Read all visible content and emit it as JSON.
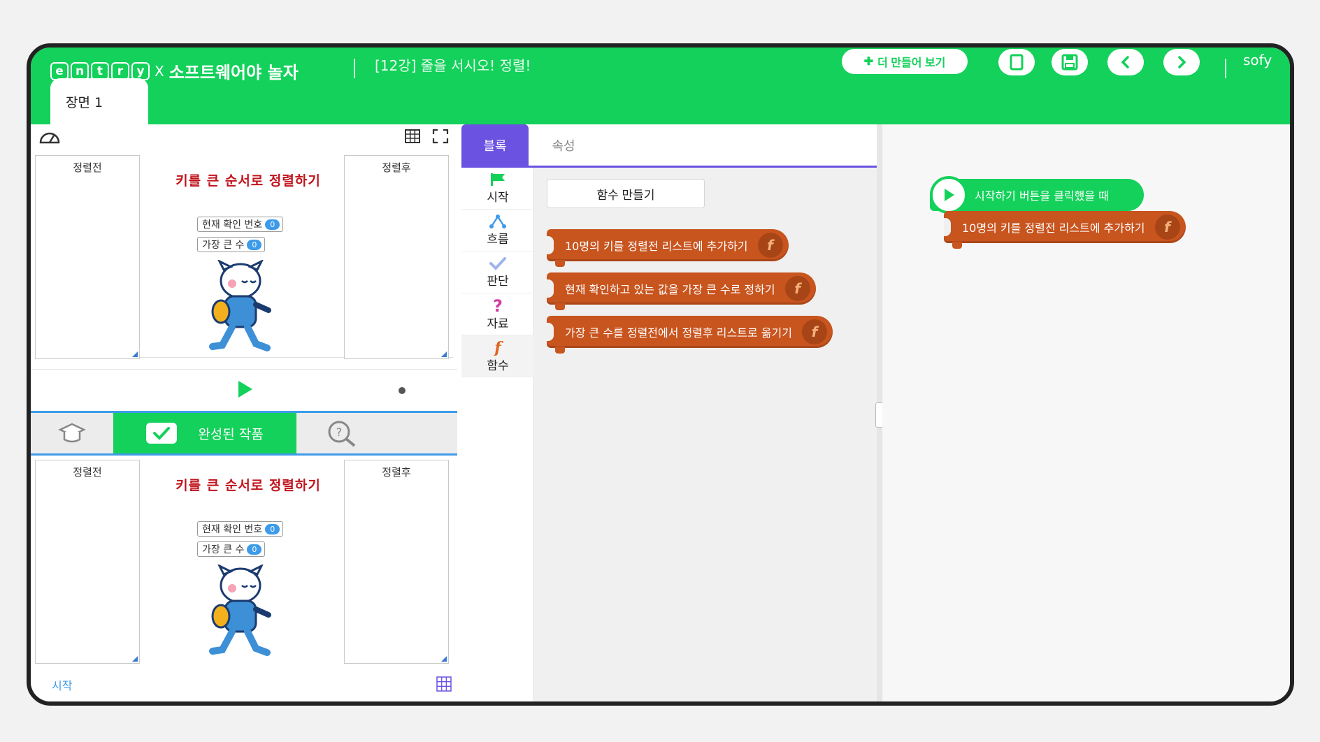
{
  "header": {
    "logo_letters": [
      "e",
      "n",
      "t",
      "r",
      "y"
    ],
    "logo_x": "X",
    "logo_brand": "소프트웨어야 놀자",
    "lesson_title": "[12강] 줄을 서시오! 정렬!",
    "make_more_label": "더 만들어 보기",
    "username": "sofy"
  },
  "scene_tab": "장면 1",
  "stage": {
    "list_before": "정렬전",
    "list_after": "정렬후",
    "title": "키를 큰 순서로 정렬하기",
    "var_current_label": "현재 확인 번호",
    "var_current_value": "0",
    "var_max_label": "가장 큰 수",
    "var_max_value": "0"
  },
  "bottom_tabs": {
    "completed_label": "완성된 작품"
  },
  "bottom_start_label": "시작",
  "block_menu": {
    "tab_blocks": "블록",
    "tab_attributes": "속성",
    "categories": [
      "시작",
      "흐름",
      "판단",
      "자료",
      "함수"
    ],
    "make_function": "함수 만들기",
    "function_blocks": [
      "10명의 키를 정렬전 리스트에 추가하기",
      "현재 확인하고 있는 값을 가장 큰 수로 정하기",
      "가장 큰 수를 정렬전에서 정렬후 리스트로 옮기기"
    ]
  },
  "workspace": {
    "start_block": "시작하기 버튼을 클릭했을 때",
    "attached_block": "10명의 키를 정렬전 리스트에 추가하기"
  },
  "colors": {
    "header_green": "#13d15a",
    "function_orange": "#c8541e",
    "block_tab_purple": "#6b52e0",
    "accent_blue": "#3d9be9",
    "title_red": "#c0141c"
  }
}
